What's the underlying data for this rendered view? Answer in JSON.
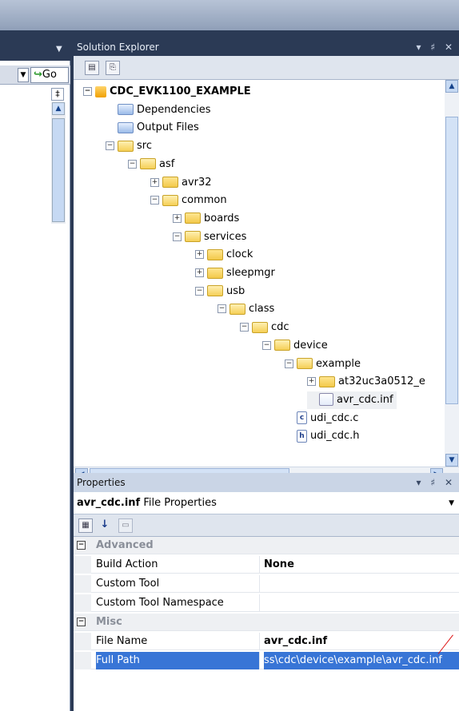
{
  "left_pane": {
    "go_label": "Go",
    "splitter_glyph": "‡"
  },
  "solution_explorer": {
    "title": "Solution Explorer",
    "title_controls": "▾ ♯ ✕",
    "toolbar_icons": [
      "properties-icon",
      "show-all-files-icon"
    ],
    "tree": [
      {
        "label": "CDC_EVK1100_EXAMPLE",
        "icon": "project-icon",
        "expander": "−",
        "bold": true
      },
      {
        "label": "Dependencies",
        "icon": "dependencies-icon",
        "expander": ""
      },
      {
        "label": "Output Files",
        "icon": "output-files-icon",
        "expander": ""
      },
      {
        "label": "src",
        "icon": "folder-open-icon",
        "expander": "−"
      },
      {
        "label": "asf",
        "icon": "folder-open-icon",
        "expander": "−"
      },
      {
        "label": "avr32",
        "icon": "folder-icon",
        "expander": "+"
      },
      {
        "label": "common",
        "icon": "folder-open-icon",
        "expander": "−"
      },
      {
        "label": "boards",
        "icon": "folder-icon",
        "expander": "+"
      },
      {
        "label": "services",
        "icon": "folder-open-icon",
        "expander": "−"
      },
      {
        "label": "clock",
        "icon": "folder-icon",
        "expander": "+"
      },
      {
        "label": "sleepmgr",
        "icon": "folder-icon",
        "expander": "+"
      },
      {
        "label": "usb",
        "icon": "folder-open-icon",
        "expander": "−"
      },
      {
        "label": "class",
        "icon": "folder-open-icon",
        "expander": "−"
      },
      {
        "label": "cdc",
        "icon": "folder-open-icon",
        "expander": "−"
      },
      {
        "label": "device",
        "icon": "folder-open-icon",
        "expander": "−"
      },
      {
        "label": "example",
        "icon": "folder-open-icon",
        "expander": "−"
      },
      {
        "label": "at32uc3a0512_e",
        "icon": "folder-icon",
        "expander": "+"
      },
      {
        "label": "avr_cdc.inf",
        "icon": "inf-file-icon",
        "expander": "",
        "selected": true
      },
      {
        "label": "udi_cdc.c",
        "icon": "c-file-icon",
        "expander": "",
        "file_glyph": "c"
      },
      {
        "label": "udi_cdc.h",
        "icon": "h-file-icon",
        "expander": "",
        "file_glyph": "h"
      }
    ]
  },
  "properties": {
    "title": "Properties",
    "title_controls": "▾ ♯ ✕",
    "object_name": "avr_cdc.inf",
    "object_type": "File Properties",
    "categories": [
      {
        "name": "Advanced",
        "rows": [
          {
            "key": "Build Action",
            "value": "None",
            "bold": true
          },
          {
            "key": "Custom Tool",
            "value": ""
          },
          {
            "key": "Custom Tool Namespace",
            "value": ""
          }
        ]
      },
      {
        "name": "Misc",
        "rows": [
          {
            "key": "File Name",
            "value": "avr_cdc.inf",
            "bold": true
          },
          {
            "key": "Full Path",
            "value": "ss\\cdc\\device\\example\\avr_cdc.inf",
            "selected": true
          }
        ]
      }
    ]
  },
  "colors": {
    "dark_chrome": "#2b3a55",
    "selection": "#3875d6"
  }
}
